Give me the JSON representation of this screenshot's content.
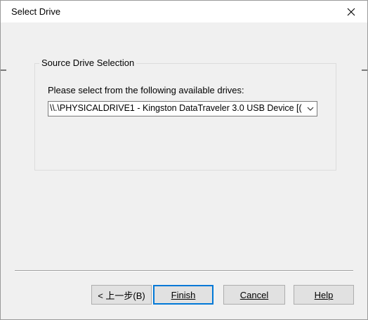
{
  "window": {
    "title": "Select Drive"
  },
  "icons": {
    "close": "close-icon",
    "dropdown": "chevron-down-icon"
  },
  "group": {
    "title": "Source Drive Selection",
    "prompt": "Please select from the following available drives:",
    "drive_select": {
      "selected": "\\\\.\\PHYSICALDRIVE1 - Kingston DataTraveler 3.0 USB Device [("
    }
  },
  "buttons": {
    "back": "< 上一步(B)",
    "finish": "Finish",
    "cancel": "Cancel",
    "help": "Help"
  }
}
